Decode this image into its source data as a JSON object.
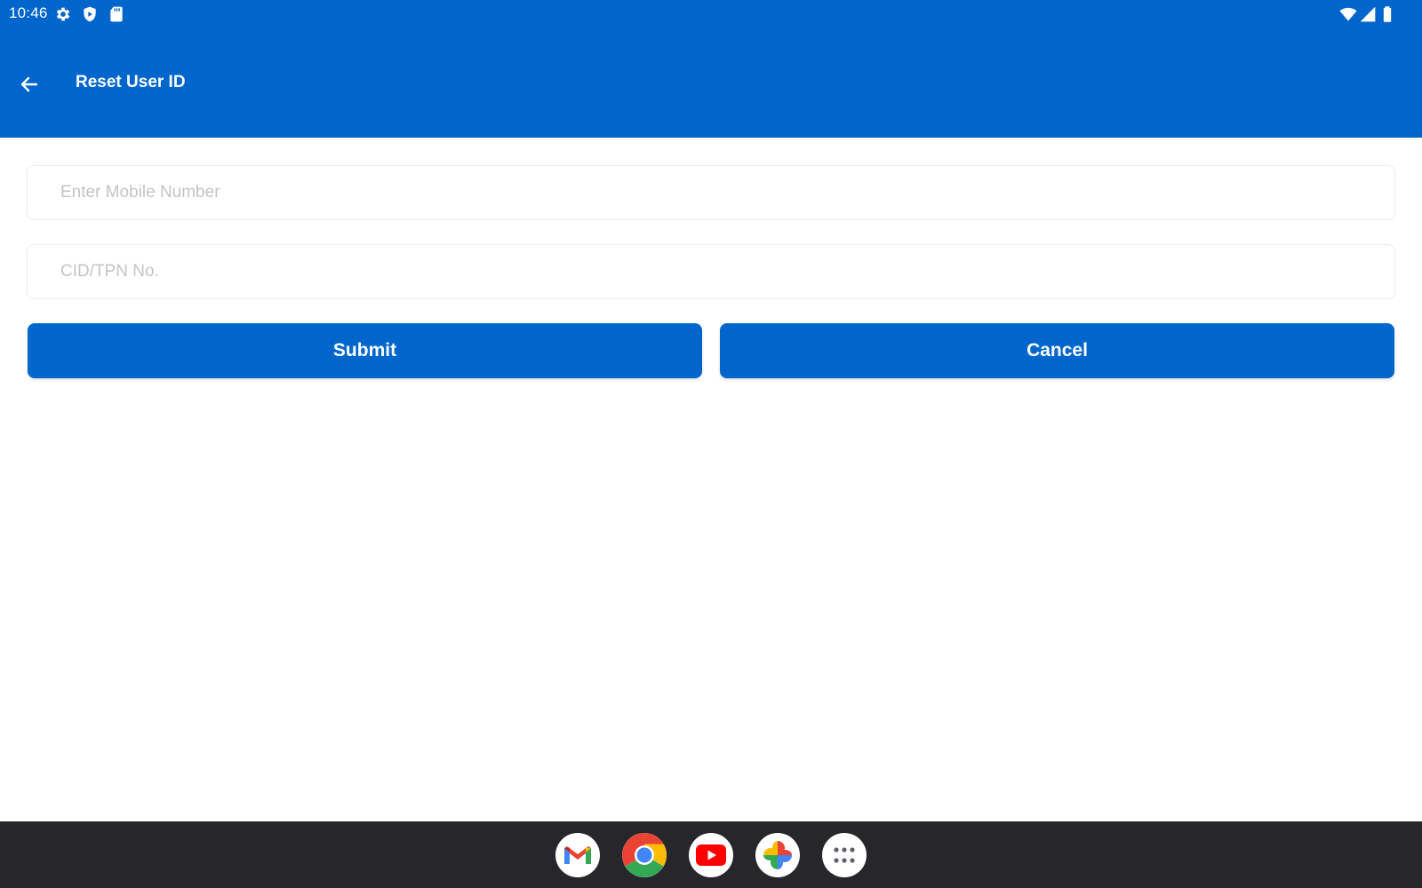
{
  "status_bar": {
    "time": "10:46",
    "left_icons": [
      "gear-icon",
      "shield-icon",
      "sd-card-icon"
    ],
    "right_icons": [
      "wifi-icon",
      "signal-icon",
      "battery-icon"
    ]
  },
  "app_bar": {
    "title": "Reset User ID",
    "back_icon": "arrow-left-icon",
    "color": "#0066cc"
  },
  "form": {
    "mobile_placeholder": "Enter Mobile Number",
    "mobile_value": "",
    "cid_placeholder": "CID/TPN No.",
    "cid_value": "",
    "submit_label": "Submit",
    "cancel_label": "Cancel"
  },
  "dock": {
    "apps": [
      "gmail-icon",
      "chrome-icon",
      "youtube-icon",
      "photos-icon",
      "app-drawer-icon"
    ]
  }
}
